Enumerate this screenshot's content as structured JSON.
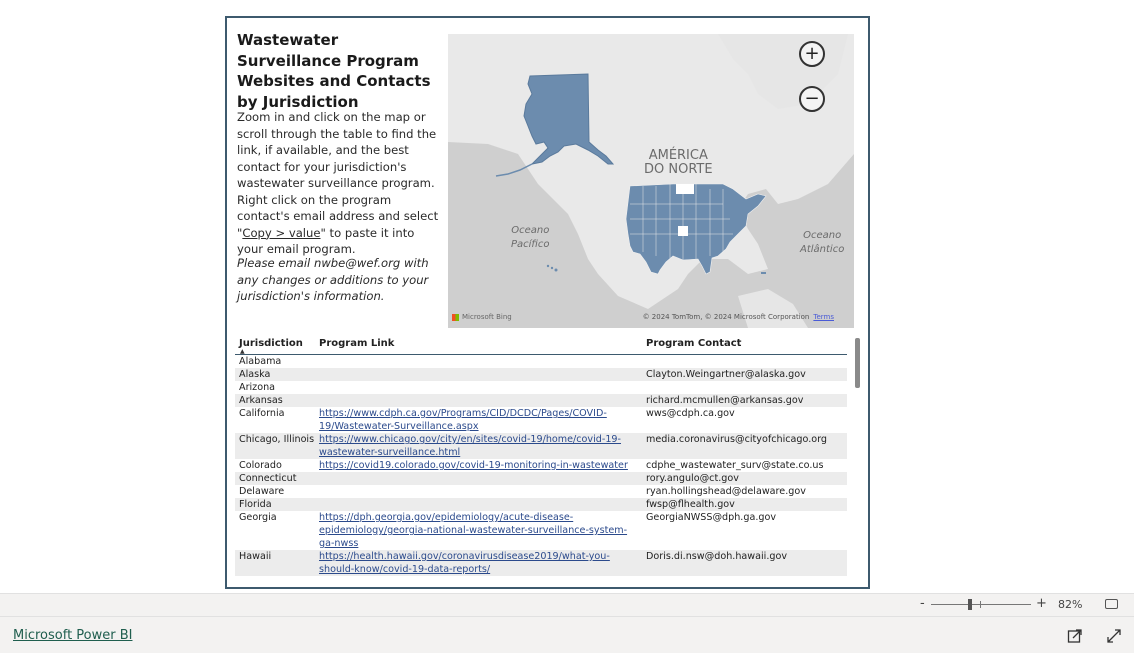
{
  "report": {
    "title": "Wastewater Surveillance Program Websites and Contacts by Jurisdiction",
    "description_part1": "Zoom in and click on the map or scroll through the table to find the link, if available, and the best contact for your jurisdiction's wastewater surveillance program. Right click on the program contact's email address and select \"",
    "description_copy": "Copy > value",
    "description_part2": "\" to paste it into your email program.",
    "note": "Please email nwbe@wef.org with any changes or additions to your jurisdiction's information."
  },
  "map": {
    "zoom_in": "+",
    "zoom_out": "−",
    "label_america": "AMÉRICA\nDO NORTE",
    "label_pacific": "Oceano\nPacífico",
    "label_atlantic": "Oceano\nAtlântico",
    "bing": "Microsoft Bing",
    "copyright": "© 2024 TomTom, © 2024 Microsoft Corporation",
    "terms": "Terms",
    "fill_color": "#6c8cae"
  },
  "table": {
    "headers": [
      "Jurisdiction",
      "Program Link",
      "Program Contact"
    ],
    "rows": [
      {
        "jurisdiction": "Alabama",
        "link": "",
        "contact": ""
      },
      {
        "jurisdiction": "Alaska",
        "link": "",
        "contact": "Clayton.Weingartner@alaska.gov"
      },
      {
        "jurisdiction": "Arizona",
        "link": "",
        "contact": ""
      },
      {
        "jurisdiction": "Arkansas",
        "link": "",
        "contact": "richard.mcmullen@arkansas.gov"
      },
      {
        "jurisdiction": "California",
        "link": "https://www.cdph.ca.gov/Programs/CID/DCDC/Pages/COVID-19/Wastewater-Surveillance.aspx",
        "contact": "wws@cdph.ca.gov"
      },
      {
        "jurisdiction": "Chicago, Illinois",
        "link": "https://www.chicago.gov/city/en/sites/covid-19/home/covid-19-wastewater-surveillance.html",
        "contact": "media.coronavirus@cityofchicago.org"
      },
      {
        "jurisdiction": "Colorado",
        "link": "https://covid19.colorado.gov/covid-19-monitoring-in-wastewater",
        "contact": "cdphe_wastewater_surv@state.co.us"
      },
      {
        "jurisdiction": "Connecticut",
        "link": "",
        "contact": "rory.angulo@ct.gov"
      },
      {
        "jurisdiction": "Delaware",
        "link": "",
        "contact": "ryan.hollingshead@delaware.gov"
      },
      {
        "jurisdiction": "Florida",
        "link": "",
        "contact": "fwsp@flhealth.gov"
      },
      {
        "jurisdiction": "Georgia",
        "link": "https://dph.georgia.gov/epidemiology/acute-disease-epidemiology/georgia-national-wastewater-surveillance-system-ga-nwss",
        "contact": "GeorgiaNWSS@dph.ga.gov"
      },
      {
        "jurisdiction": "Hawaii",
        "link": "https://health.hawaii.gov/coronavirusdisease2019/what-you-should-know/covid-19-data-reports/",
        "contact": "Doris.di.nsw@doh.hawaii.gov"
      }
    ]
  },
  "zoombar": {
    "minus": "-",
    "plus": "+",
    "percent": "82%"
  },
  "footer": {
    "powerbi": "Microsoft Power BI"
  }
}
